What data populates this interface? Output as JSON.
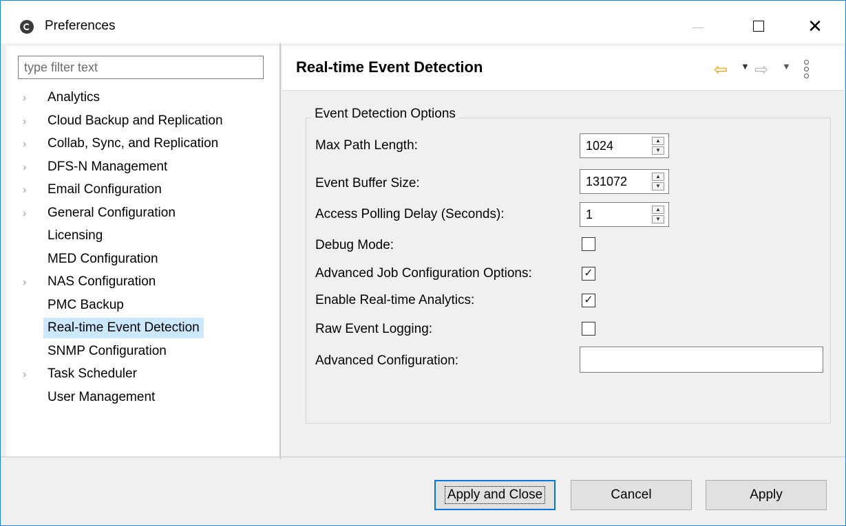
{
  "window": {
    "title": "Preferences"
  },
  "filter": {
    "placeholder": "type filter text"
  },
  "tree": [
    {
      "label": "Analytics",
      "expandable": true
    },
    {
      "label": "Cloud Backup and Replication",
      "expandable": true
    },
    {
      "label": "Collab, Sync, and Replication",
      "expandable": true
    },
    {
      "label": "DFS-N Management",
      "expandable": true
    },
    {
      "label": "Email Configuration",
      "expandable": true
    },
    {
      "label": "General Configuration",
      "expandable": true
    },
    {
      "label": "Licensing",
      "expandable": false
    },
    {
      "label": "MED Configuration",
      "expandable": false
    },
    {
      "label": "NAS Configuration",
      "expandable": true
    },
    {
      "label": "PMC Backup",
      "expandable": false
    },
    {
      "label": "Real-time Event Detection",
      "expandable": false,
      "selected": true
    },
    {
      "label": "SNMP Configuration",
      "expandable": false
    },
    {
      "label": "Task Scheduler",
      "expandable": true
    },
    {
      "label": "User Management",
      "expandable": false
    }
  ],
  "page": {
    "title": "Real-time Event Detection",
    "group_title": "Event Detection Options",
    "fields": {
      "max_path_length": {
        "label": "Max Path Length:",
        "value": "1024"
      },
      "event_buffer_size": {
        "label": "Event Buffer Size:",
        "value": "131072"
      },
      "access_polling_delay": {
        "label": "Access Polling Delay (Seconds):",
        "value": "1"
      },
      "debug_mode": {
        "label": "Debug Mode:",
        "checked": false
      },
      "advanced_job_config": {
        "label": "Advanced Job Configuration Options:",
        "checked": true
      },
      "enable_realtime_analytics": {
        "label": "Enable Real-time Analytics:",
        "checked": true
      },
      "raw_event_logging": {
        "label": "Raw Event Logging:",
        "checked": false
      },
      "advanced_configuration": {
        "label": "Advanced Configuration:",
        "value": ""
      }
    }
  },
  "buttons": {
    "apply_and_close": "Apply and Close",
    "cancel": "Cancel",
    "apply": "Apply"
  },
  "icons": {
    "back": "arrow-left-icon",
    "forward": "arrow-right-icon",
    "menu": "vertical-dots-icon"
  },
  "colors": {
    "accent": "#0078d7",
    "selection": "#cce8ff",
    "back_arrow": "#e8a500"
  }
}
